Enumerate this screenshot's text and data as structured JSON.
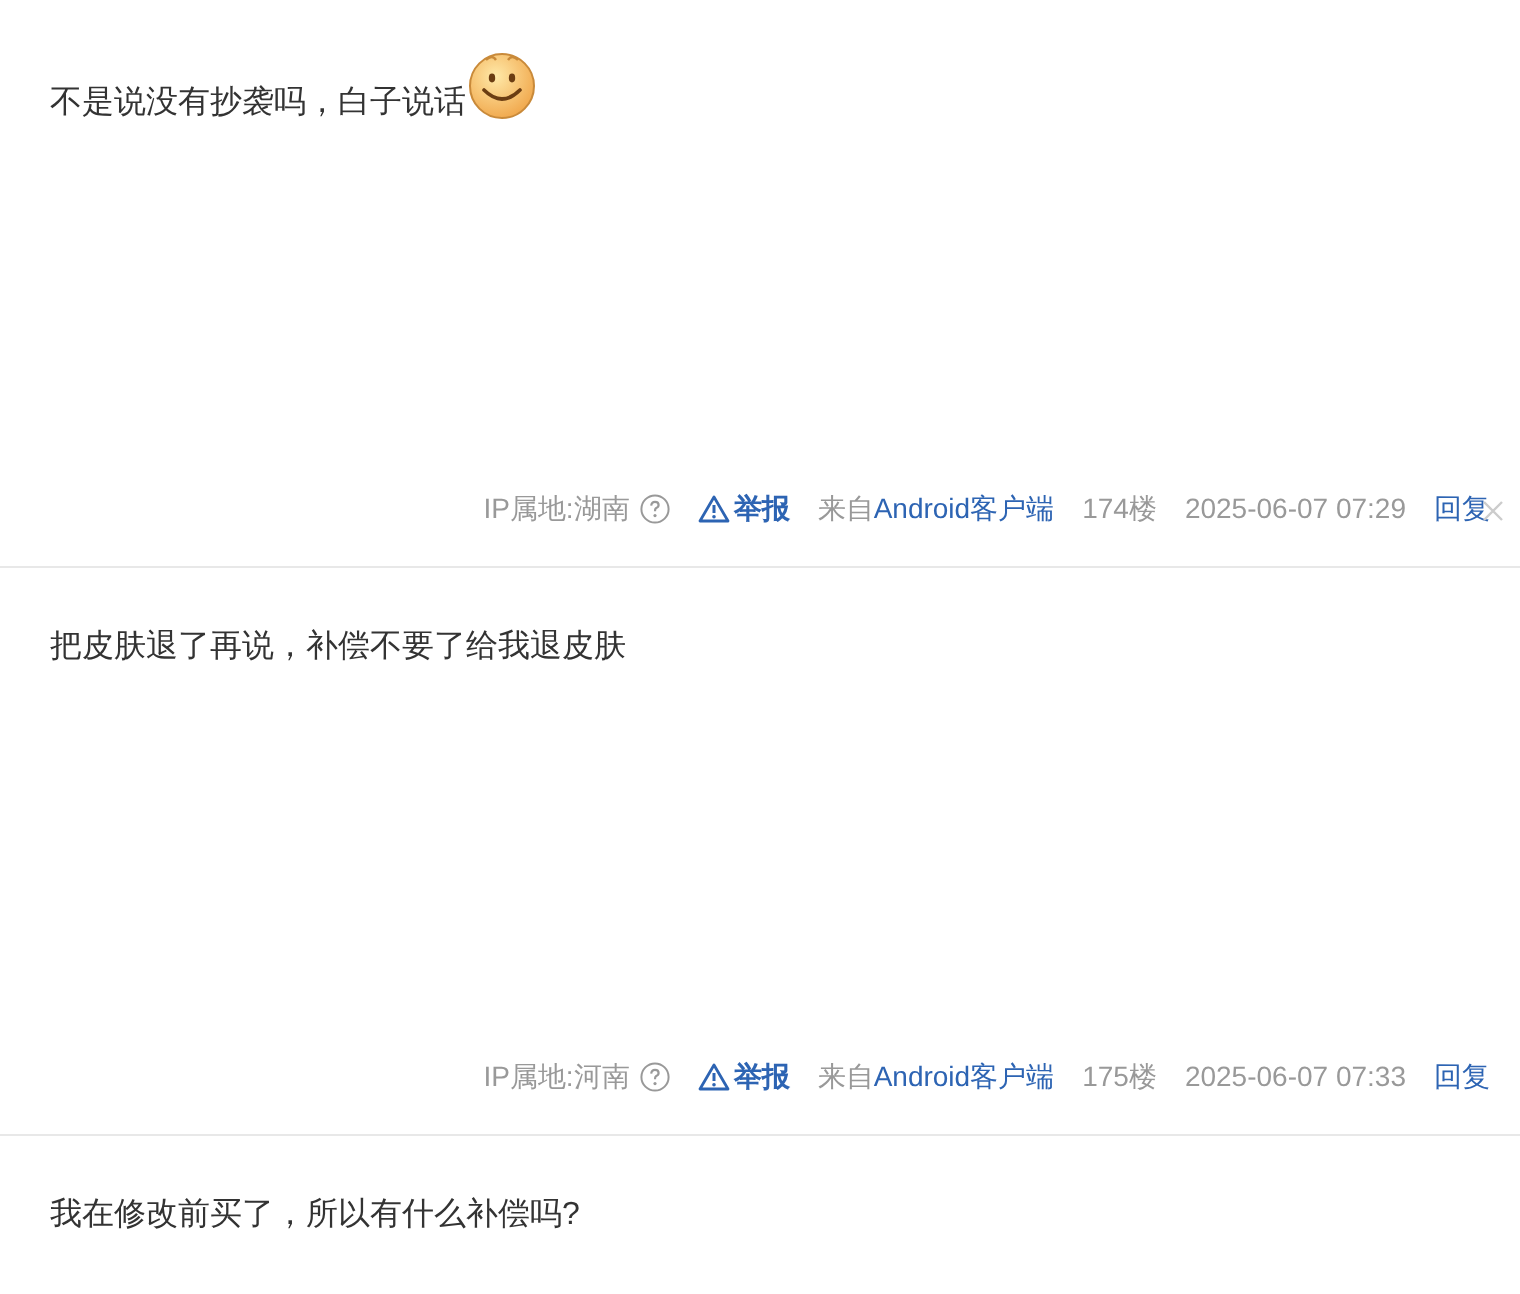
{
  "posts": [
    {
      "content": "不是说没有抄袭吗，白子说话",
      "has_emoji": true,
      "ip_location": "IP属地:湖南",
      "report": "举报",
      "source_prefix": "来自",
      "source_link": "Android客户端",
      "floor": "174楼",
      "time": "2025-06-07 07:29",
      "reply": "回复",
      "show_close": true
    },
    {
      "content": "把皮肤退了再说，补偿不要了给我退皮肤",
      "has_emoji": false,
      "ip_location": "IP属地:河南",
      "report": "举报",
      "source_prefix": "来自",
      "source_link": "Android客户端",
      "floor": "175楼",
      "time": "2025-06-07 07:33",
      "reply": "回复",
      "show_close": false
    },
    {
      "content": "我在修改前买了，所以有什么补偿吗?",
      "has_emoji": false
    }
  ]
}
